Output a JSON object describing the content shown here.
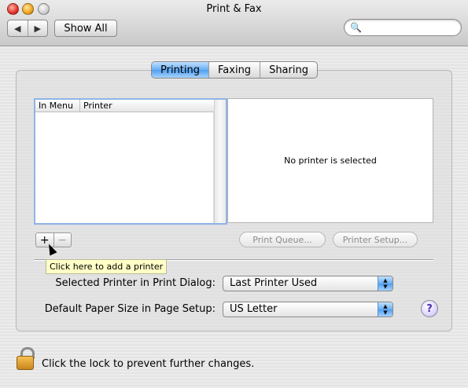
{
  "window": {
    "title": "Print & Fax"
  },
  "toolbar": {
    "back_glyph": "◀",
    "forward_glyph": "▶",
    "show_all": "Show All",
    "search_placeholder": "",
    "search_glyph": "🔍"
  },
  "tabs": [
    {
      "label": "Printing",
      "active": true
    },
    {
      "label": "Faxing",
      "active": false
    },
    {
      "label": "Sharing",
      "active": false
    }
  ],
  "printer_list": {
    "columns": [
      "In Menu",
      "Printer"
    ],
    "rows": []
  },
  "detail": {
    "message": "No printer is selected"
  },
  "buttons": {
    "add": "+",
    "remove": "−",
    "print_queue": "Print Queue...",
    "printer_setup": "Printer Setup..."
  },
  "tooltip": "Click here to add a printer",
  "settings": {
    "selected_printer_label": "Selected Printer in Print Dialog:",
    "selected_printer_value": "Last Printer Used",
    "paper_size_label": "Default Paper Size in Page Setup:",
    "paper_size_value": "US Letter"
  },
  "help_glyph": "?",
  "lock": {
    "text": "Click the lock to prevent further changes."
  },
  "colors": {
    "accent": "#4f9ef0",
    "tooltip_bg": "#ffffc6"
  }
}
